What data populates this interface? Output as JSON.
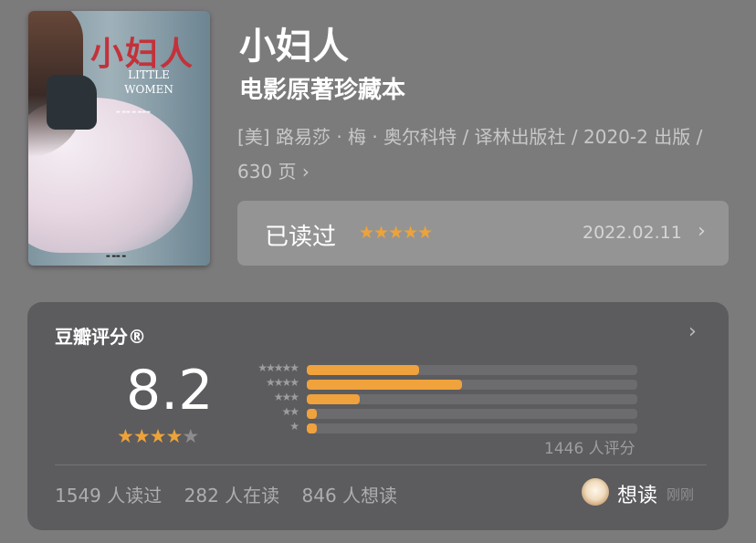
{
  "book": {
    "cover": {
      "title_cn": "小妇人",
      "title_en_line1": "LITTLE",
      "title_en_line2": "WOMEN"
    },
    "title": "小妇人",
    "subtitle": "电影原著珍藏本",
    "meta": "[美] 路易莎 · 梅 · 奥尔科特 / 译林出版社 / 2020-2 出版 / 630 页 ›"
  },
  "read_status": {
    "label": "已读过",
    "stars": "★★★★★",
    "date": "2022.02.11",
    "chevron": "›"
  },
  "rating": {
    "title": "豆瓣评分®",
    "chevron": "›",
    "score": "8.2",
    "score_stars_on": "★★★★",
    "score_stars_off": "★",
    "distribution": [
      {
        "stars": "★★★★★",
        "fraction": 0.34
      },
      {
        "stars": "★★★★",
        "fraction": 0.47
      },
      {
        "stars": "★★★",
        "fraction": 0.16
      },
      {
        "stars": "★★",
        "fraction": 0.03
      },
      {
        "stars": "★",
        "fraction": 0.03
      }
    ],
    "count": "1446 人评分"
  },
  "stats": {
    "read": "1549 人读过",
    "reading": "282 人在读",
    "want": "846 人想读"
  },
  "friend": {
    "action": "想读",
    "time": "刚刚"
  },
  "colors": {
    "accent_star": "#eca33a",
    "bar_fill": "#f0a23c",
    "background": "#7c7b7c",
    "card": "#5c5b5e"
  }
}
